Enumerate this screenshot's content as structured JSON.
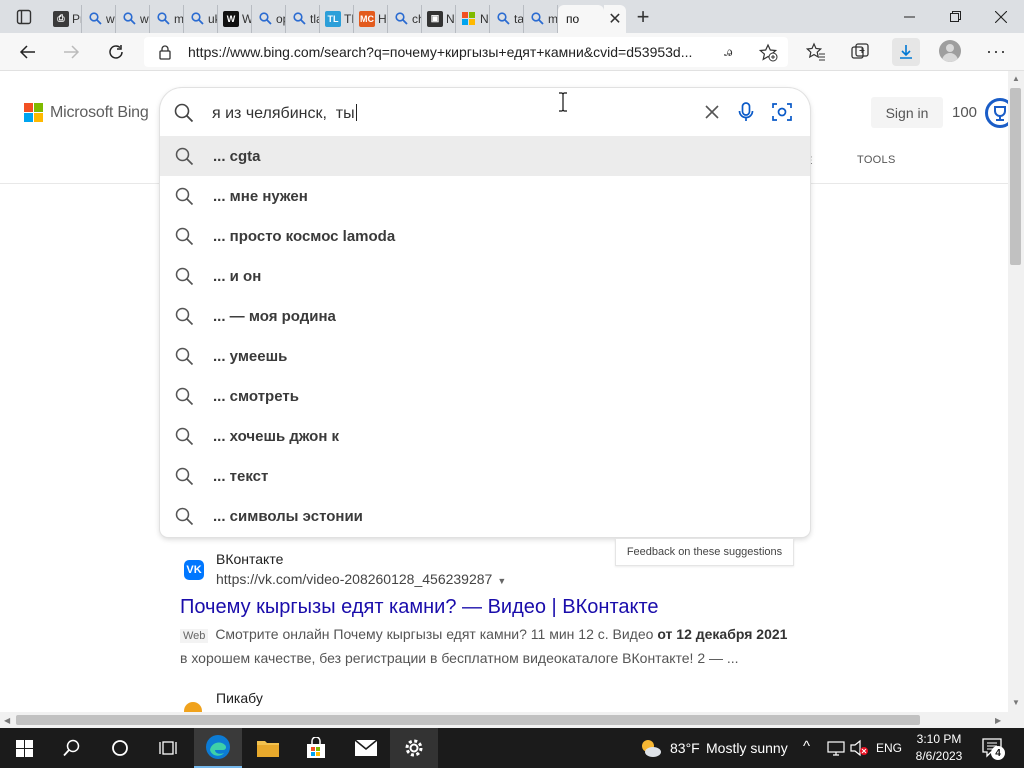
{
  "browser": {
    "tabs": [
      {
        "title": "Pr",
        "fav_color": "#3a3a3a",
        "fav_glyph": "⎙",
        "icon": "document-icon"
      },
      {
        "title": "wi",
        "fav_color": "",
        "fav_glyph": "",
        "icon": "search-icon"
      },
      {
        "title": "wi",
        "fav_color": "",
        "fav_glyph": "",
        "icon": "search-icon"
      },
      {
        "title": "m",
        "fav_color": "",
        "fav_glyph": "",
        "icon": "search-icon"
      },
      {
        "title": "uk",
        "fav_color": "",
        "fav_glyph": "",
        "icon": "search-icon"
      },
      {
        "title": "W",
        "fav_color": "#111111",
        "fav_glyph": "W",
        "icon": "wikipedia-icon"
      },
      {
        "title": "op",
        "fav_color": "",
        "fav_glyph": "",
        "icon": "search-icon"
      },
      {
        "title": "tla",
        "fav_color": "",
        "fav_glyph": "",
        "icon": "search-icon"
      },
      {
        "title": "TL",
        "fav_color": "#2c9fd9",
        "fav_glyph": "TL",
        "icon": "tl-icon"
      },
      {
        "title": "Ho",
        "fav_color": "#e35b1e",
        "fav_glyph": "MC",
        "icon": "mc-icon"
      },
      {
        "title": "ch",
        "fav_color": "",
        "fav_glyph": "",
        "icon": "search-icon"
      },
      {
        "title": "N(",
        "fav_color": "#333333",
        "fav_glyph": "▣",
        "icon": "news-icon"
      },
      {
        "title": "N(",
        "fav_color": "#f25022",
        "fav_glyph": "",
        "icon": "microsoft-icon"
      },
      {
        "title": "ta",
        "fav_color": "",
        "fav_glyph": "",
        "icon": "search-icon"
      },
      {
        "title": "m",
        "fav_color": "",
        "fav_glyph": "",
        "icon": "search-icon"
      }
    ],
    "active_tab_title": "по",
    "url": "https://www.bing.com/search?q=почему+киргызы+едят+камни&cvid=d53953d..."
  },
  "page": {
    "logo_text": "Microsoft Bing",
    "sign_in": "Sign in",
    "rewards_count": "100",
    "tools_label": "TOOLS",
    "search_query": "я из челябинск,  ты",
    "suggestions": [
      "... cgta",
      "... мне нужен",
      "... просто космос lamoda",
      "... и он",
      "... — моя родина",
      "... умеешь",
      "... смотреть",
      "... хочешь джон к",
      "... текст",
      "... символы эстонии"
    ],
    "feedback_label": "Feedback on these suggestions",
    "result": {
      "site_name": "ВКонтакте",
      "site_url": "https://vk.com/video-208260128_456239287",
      "favicon_text": "VK",
      "title": "Почему кыргызы едят камни? — Видео | ВКонтакте",
      "web_tag": "Web",
      "snippet_pre": "Смотрите онлайн Почему кыргызы едят камни? 11 мин 12 с. Видео",
      "snippet_bold": "от 12 декабря 2021",
      "snippet_post": "в хорошем качестве, без регистрации в бесплатном видеокаталоге ВКонтакте! 2 — ..."
    },
    "next_result_site": "Пикабу"
  },
  "taskbar": {
    "weather_temp": "83°F",
    "weather_desc": "Mostly sunny",
    "language": "ENG",
    "time": "3:10 PM",
    "date": "8/6/2023",
    "notifications": "4"
  },
  "colors": {
    "link": "#1a0dab",
    "accent": "#0078d4",
    "vk": "#0077ff"
  }
}
